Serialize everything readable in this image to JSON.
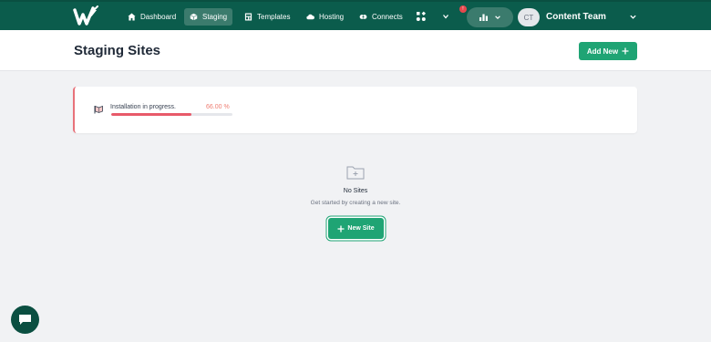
{
  "nav": {
    "items": [
      {
        "label": "Dashboard",
        "icon": "home-icon"
      },
      {
        "label": "Staging",
        "icon": "cube-icon",
        "active": true
      },
      {
        "label": "Templates",
        "icon": "template-icon"
      },
      {
        "label": "Hosting",
        "icon": "cloud-icon"
      },
      {
        "label": "Connects",
        "icon": "link-icon"
      }
    ],
    "team": {
      "avatar_initials": "CT",
      "name": "Content Team"
    },
    "notification_badge": "!"
  },
  "header": {
    "title": "Staging Sites",
    "add_new_label": "Add New"
  },
  "progress": {
    "label": "Installation in progress.",
    "percent_text": "66.00 %",
    "value": 0.66
  },
  "empty_state": {
    "title": "No Sites",
    "subtitle": "Get started by creating a new site.",
    "button_label": "New Site"
  },
  "colors": {
    "brand": "#0b5c4c",
    "accent": "#1fa474",
    "progress": "#e85a6a"
  }
}
